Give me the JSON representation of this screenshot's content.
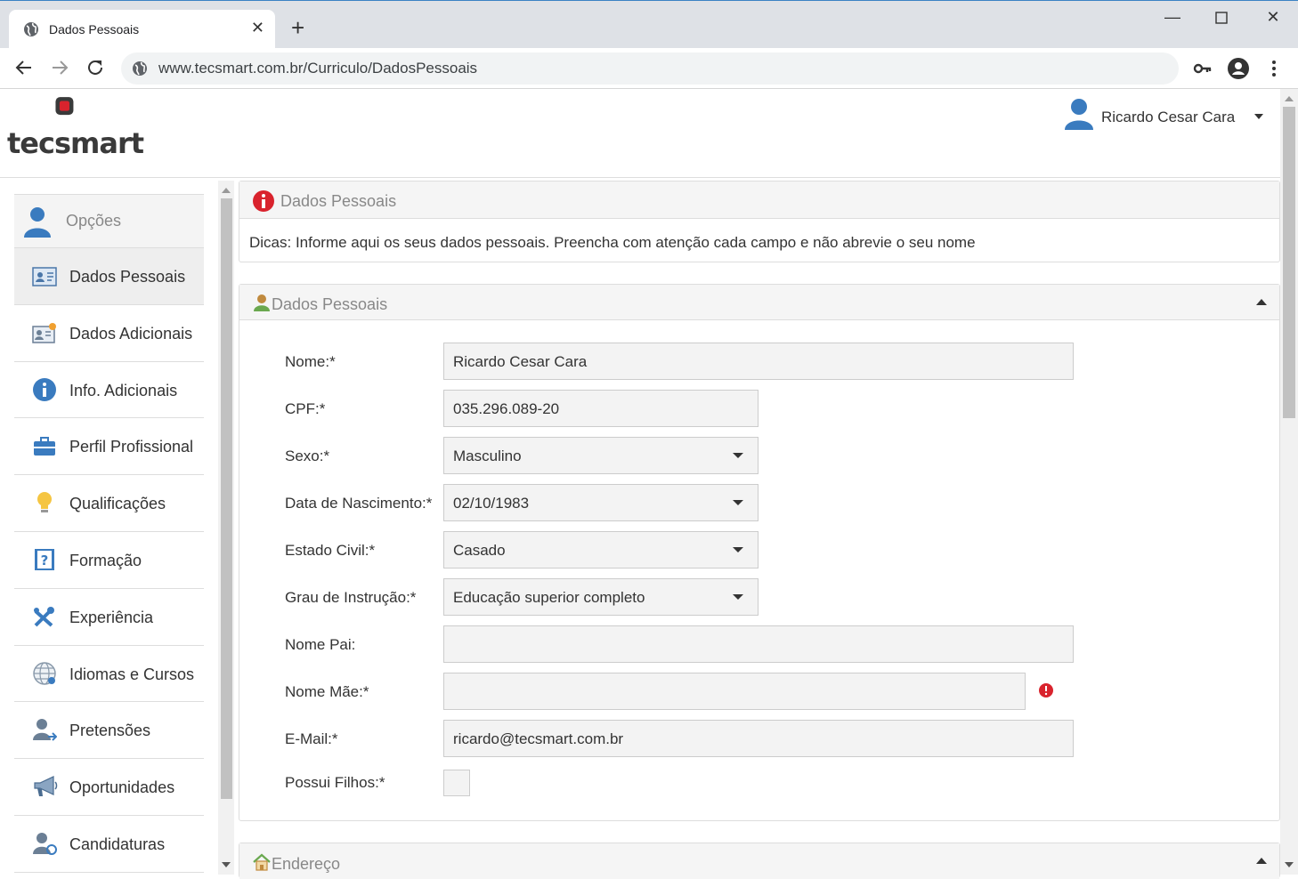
{
  "browser": {
    "tab_title": "Dados Pessoais",
    "url": "www.tecsmart.com.br/Curriculo/DadosPessoais"
  },
  "header": {
    "logo_text": "tecsmart",
    "user_name": "Ricardo Cesar Cara"
  },
  "sidebar": {
    "heading": "Opções",
    "items": [
      {
        "label": "Dados Pessoais",
        "icon": "id-card-icon"
      },
      {
        "label": "Dados Adicionais",
        "icon": "id-card-add-icon"
      },
      {
        "label": "Info. Adicionais",
        "icon": "info-icon"
      },
      {
        "label": "Perfil Profissional",
        "icon": "briefcase-icon"
      },
      {
        "label": "Qualificações",
        "icon": "lightbulb-icon"
      },
      {
        "label": "Formação",
        "icon": "book-icon"
      },
      {
        "label": "Experiência",
        "icon": "tools-icon"
      },
      {
        "label": "Idiomas e Cursos",
        "icon": "globe-icon"
      },
      {
        "label": "Pretensões",
        "icon": "user-arrow-icon"
      },
      {
        "label": "Oportunidades",
        "icon": "megaphone-icon"
      },
      {
        "label": "Candidaturas",
        "icon": "user-refresh-icon"
      }
    ]
  },
  "tip_panel": {
    "title": "Dados Pessoais",
    "text": "Dicas: Informe aqui os seus dados pessoais. Preencha com atenção cada campo e não abrevie o seu nome"
  },
  "form_panel": {
    "title": "Dados Pessoais",
    "fields": {
      "nome": {
        "label": "Nome:*",
        "value": "Ricardo Cesar Cara"
      },
      "cpf": {
        "label": "CPF:*",
        "value": "035.296.089-20"
      },
      "sexo": {
        "label": "Sexo:*",
        "value": "Masculino"
      },
      "nascimento": {
        "label": "Data de Nascimento:*",
        "value": "02/10/1983"
      },
      "estado_civil": {
        "label": "Estado Civil:*",
        "value": "Casado"
      },
      "grau": {
        "label": "Grau de Instrução:*",
        "value": "Educação superior completo"
      },
      "pai": {
        "label": "Nome Pai:",
        "value": ""
      },
      "mae": {
        "label": "Nome Mãe:*",
        "value": ""
      },
      "email": {
        "label": "E-Mail:*",
        "value": "ricardo@tecsmart.com.br"
      },
      "filhos": {
        "label": "Possui Filhos:*"
      }
    }
  },
  "address_panel": {
    "title": "Endereço"
  },
  "colors": {
    "accent_red": "#d9232d",
    "user_blue": "#3a7bbf"
  }
}
